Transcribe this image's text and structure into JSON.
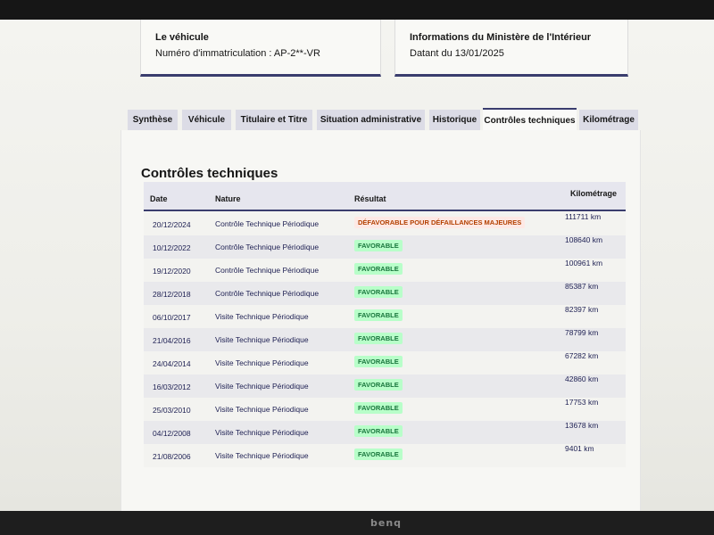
{
  "vehicle_card": {
    "title": "Le véhicule",
    "registration": "Numéro d'immatriculation : AP-2**-VR"
  },
  "ministry_card": {
    "title": "Informations du Ministère de l'Intérieur",
    "date": "Datant du 13/01/2025"
  },
  "tabs": [
    {
      "label": "Synthèse",
      "active": false
    },
    {
      "label": "Véhicule",
      "active": false
    },
    {
      "label": "Titulaire et Titre",
      "active": false
    },
    {
      "label": "Situation administrative",
      "active": false
    },
    {
      "label": "Historique",
      "active": false
    },
    {
      "label": "Contrôles techniques",
      "active": true
    },
    {
      "label": "Kilométrage",
      "active": false
    }
  ],
  "section": {
    "title": "Contrôles techniques",
    "columns": [
      "Date",
      "Nature",
      "Résultat",
      "Kilométrage"
    ],
    "rows": [
      {
        "date": "20/12/2024",
        "nature": "Contrôle Technique Périodique",
        "result": "DÉFAVORABLE POUR DÉFAILLANCES MAJEURES",
        "status": "ko",
        "km": "111711 km"
      },
      {
        "date": "10/12/2022",
        "nature": "Contrôle Technique Périodique",
        "result": "FAVORABLE",
        "status": "ok",
        "km": "108640 km"
      },
      {
        "date": "19/12/2020",
        "nature": "Contrôle Technique Périodique",
        "result": "FAVORABLE",
        "status": "ok",
        "km": "100961 km"
      },
      {
        "date": "28/12/2018",
        "nature": "Contrôle Technique Périodique",
        "result": "FAVORABLE",
        "status": "ok",
        "km": "85387 km"
      },
      {
        "date": "06/10/2017",
        "nature": "Visite Technique Périodique",
        "result": "FAVORABLE",
        "status": "ok",
        "km": "82397 km"
      },
      {
        "date": "21/04/2016",
        "nature": "Visite Technique Périodique",
        "result": "FAVORABLE",
        "status": "ok",
        "km": "78799 km"
      },
      {
        "date": "24/04/2014",
        "nature": "Visite Technique Périodique",
        "result": "FAVORABLE",
        "status": "ok",
        "km": "67282 km"
      },
      {
        "date": "16/03/2012",
        "nature": "Visite Technique Périodique",
        "result": "FAVORABLE",
        "status": "ok",
        "km": "42860 km"
      },
      {
        "date": "25/03/2010",
        "nature": "Visite Technique Périodique",
        "result": "FAVORABLE",
        "status": "ok",
        "km": "17753 km"
      },
      {
        "date": "04/12/2008",
        "nature": "Visite Technique Périodique",
        "result": "FAVORABLE",
        "status": "ok",
        "km": "13678 km"
      },
      {
        "date": "21/08/2006",
        "nature": "Visite Technique Périodique",
        "result": "FAVORABLE",
        "status": "ok",
        "km": "9401 km"
      }
    ]
  },
  "monitor": {
    "brand": "benq"
  },
  "colors": {
    "accent": "#3a3d6e",
    "favorable_bg": "#b8fec9",
    "favorable_text": "#18753c",
    "defavorable_text": "#b34000"
  }
}
